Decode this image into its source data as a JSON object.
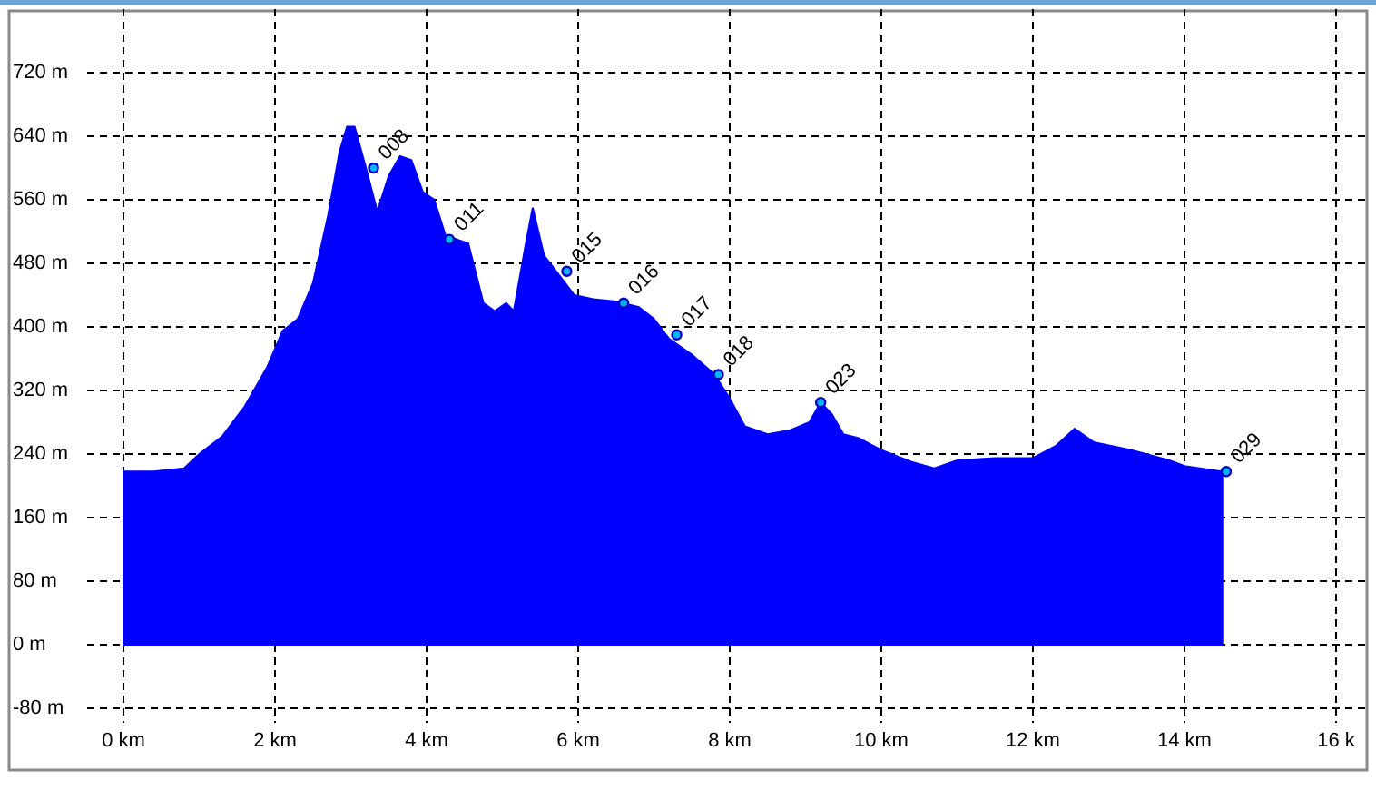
{
  "chart": {
    "chart_data": {
      "type": "area",
      "x": [
        0,
        0.4,
        0.8,
        1.0,
        1.3,
        1.6,
        1.9,
        2.1,
        2.3,
        2.5,
        2.7,
        2.85,
        2.95,
        3.05,
        3.2,
        3.35,
        3.5,
        3.65,
        3.8,
        3.95,
        4.1,
        4.25,
        4.4,
        4.55,
        4.75,
        4.9,
        5.05,
        5.15,
        5.3,
        5.4,
        5.55,
        5.75,
        5.95,
        6.2,
        6.5,
        6.8,
        7.0,
        7.2,
        7.5,
        7.8,
        8.0,
        8.2,
        8.5,
        8.8,
        9.05,
        9.2,
        9.35,
        9.5,
        9.7,
        10.0,
        10.4,
        10.7,
        11.0,
        11.5,
        12.0,
        12.3,
        12.55,
        12.8,
        13.3,
        13.8,
        14.0,
        14.5
      ],
      "series": [
        {
          "color": "#0000ff",
          "values": [
            218,
            218,
            222,
            240,
            262,
            300,
            350,
            395,
            410,
            455,
            540,
            620,
            652,
            652,
            600,
            545,
            590,
            615,
            610,
            570,
            560,
            515,
            510,
            505,
            430,
            420,
            430,
            420,
            500,
            550,
            490,
            465,
            440,
            435,
            432,
            425,
            410,
            385,
            365,
            340,
            310,
            275,
            265,
            270,
            280,
            305,
            290,
            265,
            260,
            245,
            230,
            222,
            232,
            235,
            235,
            250,
            272,
            255,
            245,
            232,
            225,
            218
          ]
        }
      ],
      "grid": true,
      "xlim": [
        0,
        16
      ],
      "ylim": [
        -80,
        800
      ],
      "xticks": [
        {
          "value": 0,
          "label": "0 km"
        },
        {
          "value": 2,
          "label": "2 km"
        },
        {
          "value": 4,
          "label": "4 km"
        },
        {
          "value": 6,
          "label": "6 km"
        },
        {
          "value": 8,
          "label": "8 km"
        },
        {
          "value": 10,
          "label": "10 km"
        },
        {
          "value": 12,
          "label": "12 km"
        },
        {
          "value": 14,
          "label": "14 km"
        },
        {
          "value": 16,
          "label": "16 k"
        }
      ],
      "yticks": [
        {
          "value": -80,
          "label": "-80 m"
        },
        {
          "value": 0,
          "label": "0 m"
        },
        {
          "value": 80,
          "label": "80 m"
        },
        {
          "value": 160,
          "label": "160 m"
        },
        {
          "value": 240,
          "label": "240 m"
        },
        {
          "value": 320,
          "label": "320 m"
        },
        {
          "value": 400,
          "label": "400 m"
        },
        {
          "value": 480,
          "label": "480 m"
        },
        {
          "value": 560,
          "label": "560 m"
        },
        {
          "value": 640,
          "label": "640 m"
        },
        {
          "value": 720,
          "label": "720 m"
        }
      ],
      "annotations": [
        {
          "x": 3.3,
          "y": 600,
          "text": "008"
        },
        {
          "x": 4.3,
          "y": 510,
          "text": "011"
        },
        {
          "x": 5.85,
          "y": 470,
          "text": "015"
        },
        {
          "x": 6.6,
          "y": 430,
          "text": "016"
        },
        {
          "x": 7.3,
          "y": 390,
          "text": "017"
        },
        {
          "x": 7.85,
          "y": 340,
          "text": "018"
        },
        {
          "x": 9.2,
          "y": 305,
          "text": "023"
        },
        {
          "x": 14.55,
          "y": 218,
          "text": "029"
        }
      ]
    }
  }
}
